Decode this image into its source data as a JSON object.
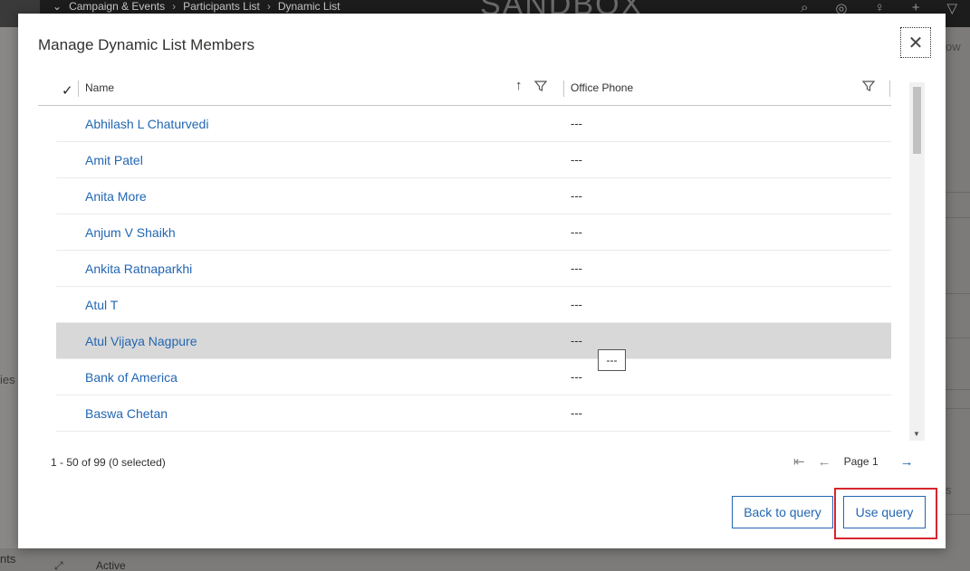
{
  "background": {
    "breadcrumbs": [
      "Campaign & Events",
      "Participants List",
      "Dynamic List"
    ],
    "watermark": "SANDBOX",
    "right_label_top": "ow",
    "right_label_mid": "s",
    "left_label": "ies",
    "bottom_left_label": "nts",
    "bottom_status": "Active"
  },
  "dialog": {
    "title": "Manage Dynamic List Members",
    "close_icon": "close-icon",
    "columns": {
      "name": "Name",
      "office_phone": "Office Phone"
    },
    "rows": [
      {
        "name": "Abhilash L Chaturvedi",
        "phone": "---"
      },
      {
        "name": "Amit Patel",
        "phone": "---"
      },
      {
        "name": "Anita More",
        "phone": "---"
      },
      {
        "name": "Anjum V Shaikh",
        "phone": "---"
      },
      {
        "name": "Ankita Ratnaparkhi",
        "phone": "---"
      },
      {
        "name": "Atul T",
        "phone": "---"
      },
      {
        "name": "Atul Vijaya Nagpure",
        "phone": "---"
      },
      {
        "name": "Bank of America",
        "phone": "---"
      },
      {
        "name": "Baswa Chetan",
        "phone": "---"
      }
    ],
    "tooltip": "---",
    "status": "1 - 50 of 99 (0 selected)",
    "page_label": "Page 1",
    "back_button": "Back to query",
    "use_button": "Use query"
  },
  "colors": {
    "link": "#2266b3",
    "highlight": "#d7262e",
    "selected_row": "#d8d8d8"
  }
}
